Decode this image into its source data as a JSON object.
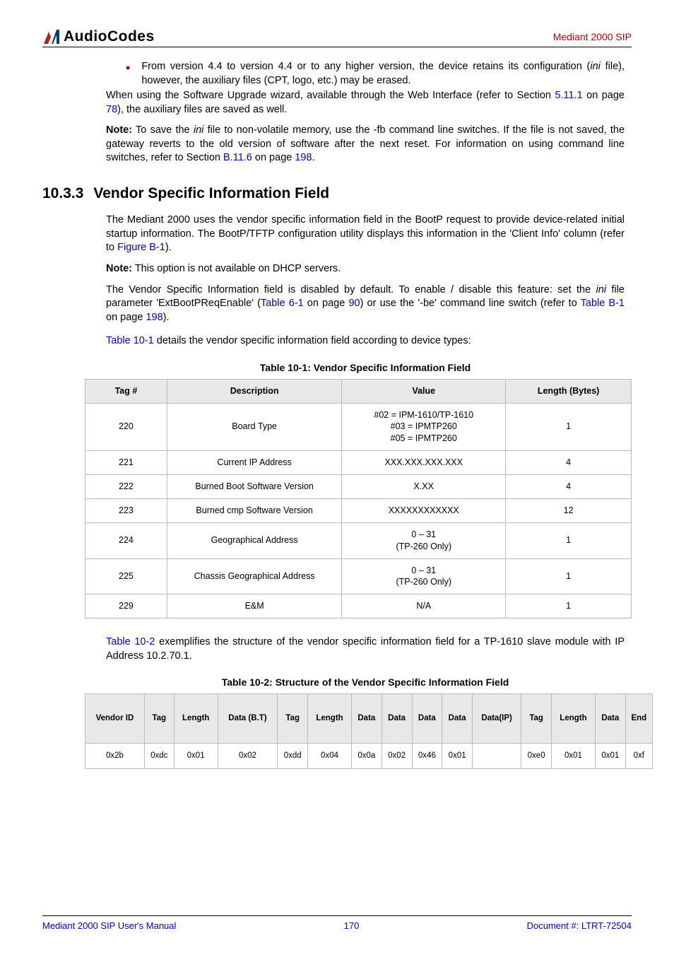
{
  "header": {
    "logo_ac": "AudioCodes",
    "right": "Mediant 2000 SIP"
  },
  "bullets": {
    "b1": "From version 4.4 to version 4.4 or to any higher version, the device retains its configuration (",
    "b1_ini": "ini",
    "b1_tail": " file), however, the auxiliary files (CPT, logo, etc.) may be erased."
  },
  "p1_a": "When using the Software Upgrade wizard, available through the Web Interface (refer to Section ",
  "p1_link1": "5.11.1",
  "p1_b": " on page ",
  "p1_link2": "78",
  "p1_c": "), the auxiliary files are saved as well.",
  "note1_label": "Note:",
  "note1_a": " To save the ",
  "note1_ini": "ini",
  "note1_b": " file to non-volatile memory, use the -fb command line switches. If the file is not saved, the gateway reverts to the old version of software after the next reset. For information on using command line switches, refer to Section ",
  "note1_link1": "B.11.6",
  "note1_c": " on page ",
  "note1_link2": "198",
  "note1_d": ".",
  "sec_num": "10.3.3",
  "sec_title": "Vendor Specific Information Field",
  "p2_a": "The Mediant 2000 uses the vendor specific information field in the BootP request to provide device-related initial startup information. The BootP/TFTP configuration utility displays this information in the 'Client Info' column (refer to ",
  "p2_link": "Figure B-1",
  "p2_b": ").",
  "note2_label": "Note:",
  "note2_a": " This option is not available on DHCP servers.",
  "p3_a": "The Vendor Specific Information field is disabled by default. To enable / disable this feature: set the ",
  "p3_ini": "ini",
  "p3_b": " file parameter 'ExtBootPReqEnable' (",
  "p3_link1": "Table 6-1",
  "p3_c": " on page ",
  "p3_link2": "90",
  "p3_d": ") or use the '-be' command line switch (refer to ",
  "p3_link3": "Table B-1",
  "p3_e": " on page ",
  "p3_link4": "198",
  "p3_f": ").",
  "p4_link": "Table 10-1",
  "p4_b": " details the vendor specific information field according to device types:",
  "t1_caption": "Table 10-1: Vendor Specific Information Field",
  "t1_head": [
    "Tag #",
    "Description",
    "Value",
    "Length (Bytes)"
  ],
  "t1_rows": [
    [
      "220",
      "Board Type",
      "#02 = IPM-1610/TP-1610\n#03 = IPMTP260\n#05 = IPMTP260",
      "1"
    ],
    [
      "221",
      "Current IP Address",
      "XXX.XXX.XXX.XXX",
      "4"
    ],
    [
      "222",
      "Burned Boot Software Version",
      "X.XX",
      "4"
    ],
    [
      "223",
      "Burned cmp Software Version",
      "XXXXXXXXXXXX",
      "12"
    ],
    [
      "224",
      "Geographical Address",
      "0 – 31\n(TP-260 Only)",
      "1"
    ],
    [
      "225",
      "Chassis Geographical Address",
      "0 – 31\n(TP-260 Only)",
      "1"
    ],
    [
      "229",
      "E&M",
      "N/A",
      "1"
    ]
  ],
  "p5_link": "Table 10-2",
  "p5_b": " exemplifies the structure of the vendor specific information field for a TP-1610 slave module with IP Address 10.2.70.1.",
  "t2_caption": "Table 10-2: Structure of the Vendor Specific Information Field",
  "t2_head": [
    "Vendor ID",
    "Tag",
    "Length",
    "Data (B.T)",
    "Tag",
    "Length",
    "Data",
    "Data",
    "Data",
    "Data",
    "Data(IP)",
    "Tag",
    "Length",
    "Data",
    "End"
  ],
  "t2_row": [
    "0x2b",
    "0xdc",
    "0x01",
    "0x02",
    "0xdd",
    "0x04",
    "0x0a",
    "0x02",
    "0x46",
    "0x01",
    "",
    "0xe0",
    "0x01",
    "0x01",
    "0xf"
  ],
  "footer": {
    "left": "Mediant 2000 SIP User's Manual",
    "center": "170",
    "right": "Document #: LTRT-72504"
  }
}
